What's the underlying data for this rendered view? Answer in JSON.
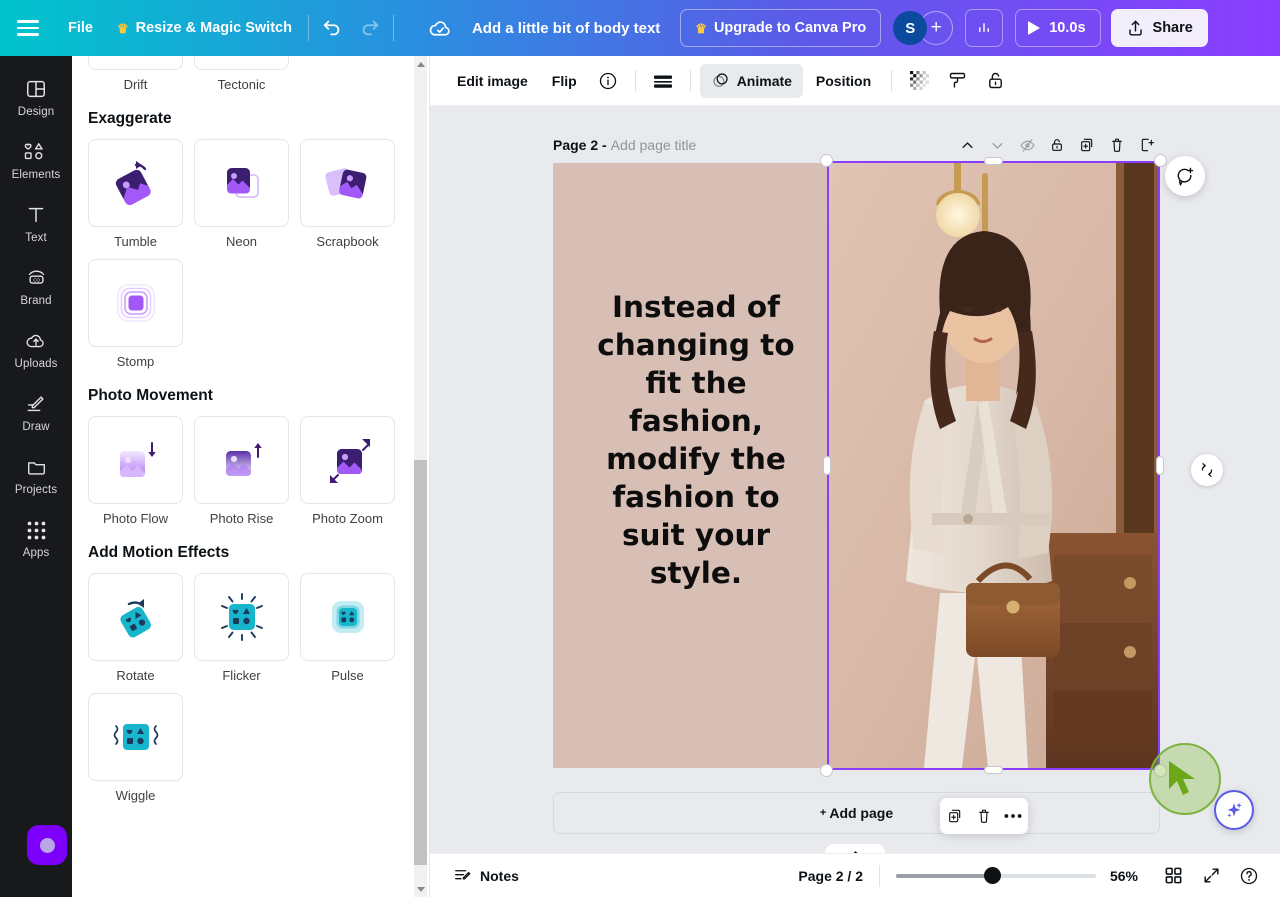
{
  "topbar": {
    "menu_icon": "hamburger-icon",
    "file_label": "File",
    "resize_label": "Resize & Magic Switch",
    "crown_glyph": "♛",
    "undo_icon": "undo-icon",
    "redo_icon": "redo-icon",
    "cloud_icon": "cloud-saved-icon",
    "doc_title": "Add a little bit of body text",
    "upgrade_label": "Upgrade to Canva Pro",
    "avatar_initial": "S",
    "add_member_glyph": "+",
    "insights_icon": "insights-bar-chart-icon",
    "play_icon": "play-icon",
    "duration_label": "10.0s",
    "share_icon": "share-upload-icon",
    "share_label": "Share"
  },
  "rail": {
    "items": [
      {
        "label": "Design",
        "icon": "design-layout-icon"
      },
      {
        "label": "Elements",
        "icon": "elements-shapes-icon"
      },
      {
        "label": "Text",
        "icon": "text-t-icon"
      },
      {
        "label": "Brand",
        "icon": "brand-icon"
      },
      {
        "label": "Uploads",
        "icon": "uploads-cloud-icon"
      },
      {
        "label": "Draw",
        "icon": "draw-pencil-icon"
      },
      {
        "label": "Projects",
        "icon": "projects-folder-icon"
      },
      {
        "label": "Apps",
        "icon": "apps-grid-icon"
      }
    ],
    "float_button": "recording-dot-button"
  },
  "panel": {
    "partial_row": [
      {
        "label": "Drift"
      },
      {
        "label": "Tectonic"
      }
    ],
    "sections": [
      {
        "title": "Exaggerate",
        "items": [
          {
            "label": "Tumble",
            "icon": "tumble-animation-icon"
          },
          {
            "label": "Neon",
            "icon": "neon-animation-icon"
          },
          {
            "label": "Scrapbook",
            "icon": "scrapbook-animation-icon"
          },
          {
            "label": "Stomp",
            "icon": "stomp-animation-icon"
          }
        ]
      },
      {
        "title": "Photo Movement",
        "items": [
          {
            "label": "Photo Flow",
            "icon": "photo-flow-icon"
          },
          {
            "label": "Photo Rise",
            "icon": "photo-rise-icon"
          },
          {
            "label": "Photo Zoom",
            "icon": "photo-zoom-icon"
          }
        ]
      },
      {
        "title": "Add Motion Effects",
        "items": [
          {
            "label": "Rotate",
            "icon": "rotate-motion-icon"
          },
          {
            "label": "Flicker",
            "icon": "flicker-motion-icon"
          },
          {
            "label": "Pulse",
            "icon": "pulse-motion-icon"
          },
          {
            "label": "Wiggle",
            "icon": "wiggle-motion-icon"
          }
        ]
      }
    ]
  },
  "edbar": {
    "edit_image": "Edit image",
    "flip": "Flip",
    "info_icon": "info-circle-icon",
    "transparency_icon": "transparency-bars-icon",
    "animate_icon": "animate-icon",
    "animate_label": "Animate",
    "position_label": "Position",
    "checker_icon": "transparency-checker-icon",
    "paint_icon": "paint-roller-icon",
    "lock_icon": "unlock-icon"
  },
  "canvas": {
    "page_label": "Page 2 -",
    "page_title_placeholder": "Add page title",
    "page_tools": [
      {
        "icon": "chevron-up-icon"
      },
      {
        "icon": "chevron-down-icon"
      },
      {
        "icon": "hide-page-icon"
      },
      {
        "icon": "unlock-page-icon"
      },
      {
        "icon": "duplicate-page-icon"
      },
      {
        "icon": "delete-page-icon"
      },
      {
        "icon": "add-page-after-icon"
      }
    ],
    "quote_text": "Instead of changing to fit the fashion, modify the fashion to suit your style.",
    "background_color": "#d8bfb5",
    "selection_color": "#8b3dff",
    "comment_icon": "add-comment-icon",
    "rotate_icon": "rotate-handle-icon",
    "add_page_plus": "+",
    "add_page_label": "Add page",
    "context_menu": [
      {
        "icon": "duplicate-icon"
      },
      {
        "icon": "trash-icon"
      },
      {
        "icon": "more-options-icon"
      }
    ],
    "collapse_icon": "chevron-up-icon",
    "ai_icon": "magic-sparkle-icon",
    "cursor_icon": "green-pointer-cursor"
  },
  "botbar": {
    "notes_icon": "notes-icon",
    "notes_label": "Notes",
    "page_indicator": "Page 2 / 2",
    "zoom_level": "56%",
    "grid_icon": "grid-view-icon",
    "fullscreen_icon": "fullscreen-icon",
    "help_icon": "help-circle-icon"
  }
}
